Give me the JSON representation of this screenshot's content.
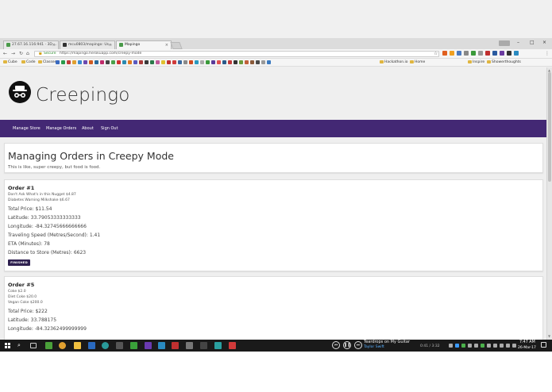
{
  "browser": {
    "tabs": [
      {
        "label": "27.67.16.116:941 · 3D ..."
      },
      {
        "label": "mcu0803/mapingo: Us..."
      },
      {
        "label": "Mapingo"
      }
    ],
    "window_controls": {
      "minimize": "–",
      "maximize": "□",
      "close": "×"
    },
    "secure_label": "Secure",
    "url": "https://mapingo.herokuapp.com/creepy-mode",
    "bookmarks": [
      {
        "label": "Cube"
      },
      {
        "label": "Code"
      },
      {
        "label": "Classes"
      },
      {
        "label": "Hackathon.io"
      },
      {
        "label": "Home"
      },
      {
        "label": "Inspire"
      },
      {
        "label": "Showerthoughts"
      }
    ]
  },
  "site": {
    "brand": "Creepingo",
    "nav": [
      "Manage Store",
      "Manage Orders",
      "About",
      "Sign Out"
    ]
  },
  "header_card": {
    "title": "Managing Orders in Creepy Mode",
    "subtitle": "This is like, super creepy, but food is food."
  },
  "orders": [
    {
      "title": "Order #1",
      "items": [
        "Don't Ask What's in this Nugget $4.87",
        "Diabetes Warning Milkshake $6.67"
      ],
      "total": "Total Price: $11.54",
      "latitude": "Latitude: 33.79053333333333",
      "longitude": "Longitude: -84.32745666666666",
      "speed": "Traveling Speed (Metres/Second): 1.41",
      "eta": "ETA (Minutes): 78",
      "distance": "Distance to Store (Metres): 6623",
      "button": "FINISHED"
    },
    {
      "title": "Order #5",
      "items": [
        "Coke $2.0",
        "Diet Coke $20.0",
        "Vegan Coke $200.0"
      ],
      "total": "Total Price: $222",
      "latitude": "Latitude: 33.788175",
      "longitude": "Longitude: -84.32362499999999"
    }
  ],
  "taskbar": {
    "song_title": "Teardrops on My Guitar",
    "song_artist": "Taylor Swift",
    "song_time": "0:41 / 3:32",
    "clock_time": "7:47 AM",
    "clock_date": "26-Mar-17"
  },
  "colors": {
    "navbar": "#432874",
    "button": "#2f2150",
    "taskbar": "#1a1a1a"
  }
}
